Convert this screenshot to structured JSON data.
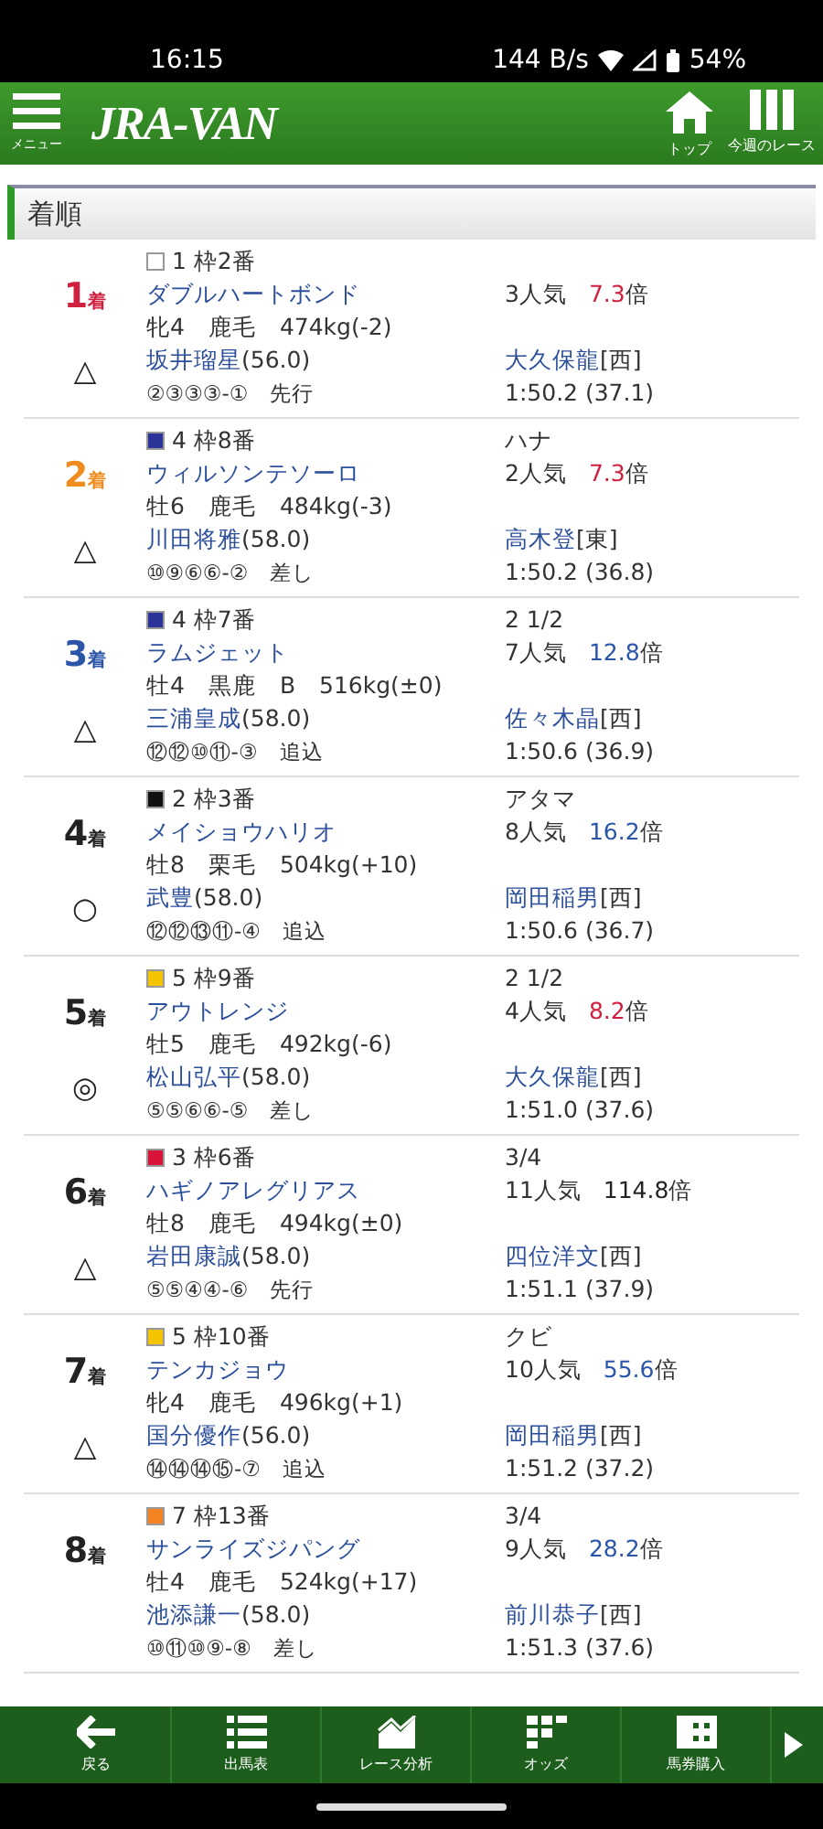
{
  "status_bar": {
    "time": "16:15",
    "net_speed": "144 B/s",
    "battery": "54%"
  },
  "header": {
    "menu_label": "メニュー",
    "logo": "JRA-VAN",
    "nav": [
      {
        "kind": "home",
        "label": "トップ"
      },
      {
        "kind": "columns",
        "label": "今週のレース"
      }
    ]
  },
  "section_title": "着順",
  "results": [
    {
      "rank": {
        "number": "1",
        "suffix": "着",
        "color": "#d0203f"
      },
      "mark": "△",
      "frame": {
        "label": "1 枠2番",
        "color": "#ffffff"
      },
      "horse": "ダブルハートボンド",
      "profile": "牝4　鹿毛　474kg(-2)",
      "jockey": "坂井瑠星",
      "weight": "(56.0)",
      "passing": "②③③③-①　先行",
      "popularity": "3人気",
      "odds": {
        "text": "7.3",
        "unit": "倍",
        "color": "#d0203f"
      },
      "trainer": "大久保龍",
      "region": "[西]",
      "time": "1:50.2 (37.1)"
    },
    {
      "rank": {
        "number": "2",
        "suffix": "着",
        "color": "#f08c1e"
      },
      "mark": "△",
      "frame": {
        "label": "4 枠8番",
        "color": "#2b3399"
      },
      "margin": "ハナ",
      "horse": "ウィルソンテソーロ",
      "profile": "牡6　鹿毛　484kg(-3)",
      "jockey": "川田将雅",
      "weight": "(58.0)",
      "passing": "⑩⑨⑥⑥-②　差し",
      "popularity": "2人気",
      "odds": {
        "text": "7.3",
        "unit": "倍",
        "color": "#d0203f"
      },
      "trainer": "高木登",
      "region": "[東]",
      "time": "1:50.2 (36.8)"
    },
    {
      "rank": {
        "number": "3",
        "suffix": "着",
        "color": "#2a55a8"
      },
      "mark": "△",
      "frame": {
        "label": "4 枠7番",
        "color": "#2b3399"
      },
      "margin": "2 1/2",
      "horse": "ラムジェット",
      "profile": "牡4　黒鹿　B　516kg(±0)",
      "jockey": "三浦皇成",
      "weight": "(58.0)",
      "passing": "⑫⑫⑩⑪-③　追込",
      "popularity": "7人気",
      "odds": {
        "text": "12.8",
        "unit": "倍",
        "color": "#2a55a8"
      },
      "trainer": "佐々木晶",
      "region": "[西]",
      "time": "1:50.6 (36.9)"
    },
    {
      "rank": {
        "number": "4",
        "suffix": "着",
        "color": "#222222"
      },
      "mark": "○",
      "frame": {
        "label": "2 枠3番",
        "color": "#111111"
      },
      "margin": "アタマ",
      "horse": "メイショウハリオ",
      "profile": "牡8　栗毛　504kg(+10)",
      "jockey": "武豊",
      "weight": "(58.0)",
      "passing": "⑫⑫⑬⑪-④　追込",
      "popularity": "8人気",
      "odds": {
        "text": "16.2",
        "unit": "倍",
        "color": "#2a55a8"
      },
      "trainer": "岡田稲男",
      "region": "[西]",
      "time": "1:50.6 (36.7)"
    },
    {
      "rank": {
        "number": "5",
        "suffix": "着",
        "color": "#222222"
      },
      "mark": "◎",
      "frame": {
        "label": "5 枠9番",
        "color": "#f5c400"
      },
      "margin": "2 1/2",
      "horse": "アウトレンジ",
      "profile": "牡5　鹿毛　492kg(-6)",
      "jockey": "松山弘平",
      "weight": "(58.0)",
      "passing": "⑤⑤⑥⑥-⑤　差し",
      "popularity": "4人気",
      "odds": {
        "text": "8.2",
        "unit": "倍",
        "color": "#d0203f"
      },
      "trainer": "大久保龍",
      "region": "[西]",
      "time": "1:51.0 (37.6)"
    },
    {
      "rank": {
        "number": "6",
        "suffix": "着",
        "color": "#222222"
      },
      "mark": "△",
      "frame": {
        "label": "3 枠6番",
        "color": "#d8143a"
      },
      "margin": "3/4",
      "horse": "ハギノアレグリアス",
      "profile": "牡8　鹿毛　494kg(±0)",
      "jockey": "岩田康誠",
      "weight": "(58.0)",
      "passing": "⑤⑤④④-⑥　先行",
      "popularity": "11人気",
      "odds": {
        "text": "114.8",
        "unit": "倍",
        "color": "#222222"
      },
      "trainer": "四位洋文",
      "region": "[西]",
      "time": "1:51.1 (37.9)"
    },
    {
      "rank": {
        "number": "7",
        "suffix": "着",
        "color": "#222222"
      },
      "mark": "△",
      "frame": {
        "label": "5 枠10番",
        "color": "#f5c400"
      },
      "margin": "クビ",
      "horse": "テンカジョウ",
      "profile": "牝4　鹿毛　496kg(+1)",
      "jockey": "国分優作",
      "weight": "(56.0)",
      "passing": "⑭⑭⑭⑮-⑦　追込",
      "popularity": "10人気",
      "odds": {
        "text": "55.6",
        "unit": "倍",
        "color": "#2a55a8"
      },
      "trainer": "岡田稲男",
      "region": "[西]",
      "time": "1:51.2 (37.2)"
    },
    {
      "rank": {
        "number": "8",
        "suffix": "着",
        "color": "#222222"
      },
      "frame": {
        "label": "7 枠13番",
        "color": "#f58220"
      },
      "margin": "3/4",
      "horse": "サンライズジパング",
      "profile": "牡4　鹿毛　524kg(+17)",
      "jockey": "池添謙一",
      "weight": "(58.0)",
      "passing": "⑩⑪⑩⑨-⑧　差し",
      "popularity": "9人気",
      "odds": {
        "text": "28.2",
        "unit": "倍",
        "color": "#2a55a8"
      },
      "trainer": "前川恭子",
      "region": "[西]",
      "time": "1:51.3 (37.6)"
    }
  ],
  "bottom_nav": [
    {
      "kind": "back",
      "label": "戻る"
    },
    {
      "kind": "list",
      "label": "出馬表"
    },
    {
      "kind": "chart",
      "label": "レース分析"
    },
    {
      "kind": "odds",
      "label": "オッズ"
    },
    {
      "kind": "ticket",
      "label": "馬券購入"
    },
    {
      "kind": "next"
    }
  ]
}
